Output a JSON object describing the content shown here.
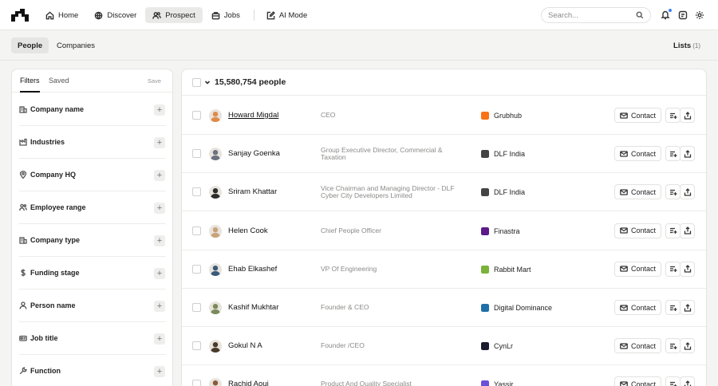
{
  "nav": {
    "items": [
      {
        "label": "Home",
        "icon": "home-icon",
        "active": false
      },
      {
        "label": "Discover",
        "icon": "globe-icon",
        "active": false
      },
      {
        "label": "Prospect",
        "icon": "users-icon",
        "active": true
      },
      {
        "label": "Jobs",
        "icon": "briefcase-icon",
        "active": false
      },
      {
        "label": "AI Mode",
        "icon": "edit-icon",
        "active": false
      }
    ],
    "search_placeholder": "Search..."
  },
  "subnav": {
    "tabs": [
      {
        "label": "People",
        "active": true
      },
      {
        "label": "Companies",
        "active": false
      }
    ],
    "lists_label": "Lists",
    "lists_count": "(1)"
  },
  "filters": {
    "tabs": [
      {
        "label": "Filters",
        "active": true
      },
      {
        "label": "Saved",
        "active": false
      }
    ],
    "save_label": "Save",
    "items": [
      {
        "label": "Company name",
        "icon": "building-icon"
      },
      {
        "label": "Industries",
        "icon": "factory-icon"
      },
      {
        "label": "Company HQ",
        "icon": "location-pin-icon"
      },
      {
        "label": "Employee range",
        "icon": "users-icon"
      },
      {
        "label": "Company type",
        "icon": "building-icon"
      },
      {
        "label": "Funding stage",
        "icon": "dollar-icon"
      },
      {
        "label": "Person name",
        "icon": "user-icon"
      },
      {
        "label": "Job title",
        "icon": "id-badge-icon"
      },
      {
        "label": "Function",
        "icon": "wrench-icon"
      }
    ]
  },
  "results": {
    "count_label": "15,580,754 people",
    "contact_label": "Contact",
    "rows": [
      {
        "name": "Howard Migdal",
        "title": "CEO",
        "company": "Grubhub",
        "company_color": "#f97316",
        "avatar_color": "#e08a4a"
      },
      {
        "name": "Sanjay Goenka",
        "title": "Group Executive Director, Commercial & Taxation",
        "company": "DLF India",
        "company_color": "#444444",
        "avatar_color": "#6b7280"
      },
      {
        "name": "Sriram Khattar",
        "title": "Vice Chairman and Managing Director - DLF Cyber City Developers Limited",
        "company": "DLF India",
        "company_color": "#444444",
        "avatar_color": "#2d2d2d"
      },
      {
        "name": "Helen Cook",
        "title": "Chief People Officer",
        "company": "Finastra",
        "company_color": "#5b1a8a",
        "avatar_color": "#c9a27a"
      },
      {
        "name": "Ehab Elkashef",
        "title": "VP Of Engineering",
        "company": "Rabbit Mart",
        "company_color": "#7ab23a",
        "avatar_color": "#3a5a7a"
      },
      {
        "name": "Kashif Mukhtar",
        "title": "Founder & CEO",
        "company": "Digital Dominance",
        "company_color": "#1e6fa8",
        "avatar_color": "#7a8a5a"
      },
      {
        "name": "Gokul N A",
        "title": "Founder /CEO",
        "company": "CynLr",
        "company_color": "#1a1a2e",
        "avatar_color": "#4a3a2a"
      },
      {
        "name": "Rachid Aoui",
        "title": "Product And Quality Specialist",
        "company": "Yassir",
        "company_color": "#6b4fd8",
        "avatar_color": "#8a5a3a"
      }
    ]
  }
}
